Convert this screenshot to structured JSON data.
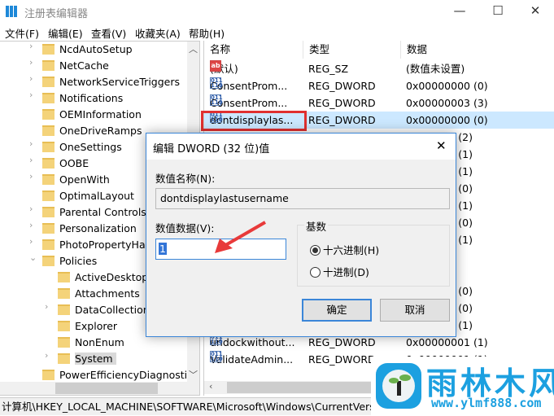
{
  "window": {
    "title": "注册表编辑器",
    "minimize": "—",
    "maximize": "☐",
    "close": "✕"
  },
  "menu": [
    "文件(F)",
    "编辑(E)",
    "查看(V)",
    "收藏夹(A)",
    "帮助(H)"
  ],
  "tree": {
    "items": [
      {
        "label": "NcdAutoSetup",
        "level": 1,
        "arrow": "›"
      },
      {
        "label": "NetCache",
        "level": 1,
        "arrow": "›"
      },
      {
        "label": "NetworkServiceTriggers",
        "level": 1,
        "arrow": "›"
      },
      {
        "label": "Notifications",
        "level": 1,
        "arrow": "›"
      },
      {
        "label": "OEMInformation",
        "level": 1,
        "arrow": ""
      },
      {
        "label": "OneDriveRamps",
        "level": 1,
        "arrow": ""
      },
      {
        "label": "OneSettings",
        "level": 1,
        "arrow": "›"
      },
      {
        "label": "OOBE",
        "level": 1,
        "arrow": "›"
      },
      {
        "label": "OpenWith",
        "level": 1,
        "arrow": "›"
      },
      {
        "label": "OptimalLayout",
        "level": 1,
        "arrow": ""
      },
      {
        "label": "Parental Controls",
        "level": 1,
        "arrow": "›"
      },
      {
        "label": "Personalization",
        "level": 1,
        "arrow": "›"
      },
      {
        "label": "PhotoPropertyHandler",
        "level": 1,
        "arrow": "›"
      },
      {
        "label": "Policies",
        "level": 1,
        "arrow": "⌄"
      },
      {
        "label": "ActiveDesktop",
        "level": 2,
        "arrow": ""
      },
      {
        "label": "Attachments",
        "level": 2,
        "arrow": ""
      },
      {
        "label": "DataCollection",
        "level": 2,
        "arrow": "›"
      },
      {
        "label": "Explorer",
        "level": 2,
        "arrow": ""
      },
      {
        "label": "NonEnum",
        "level": 2,
        "arrow": ""
      },
      {
        "label": "System",
        "level": 2,
        "arrow": "›",
        "selected": true
      },
      {
        "label": "PowerEfficiencyDiagnostics",
        "level": 1,
        "arrow": ""
      }
    ]
  },
  "list": {
    "headers": [
      "名称",
      "类型",
      "数据"
    ],
    "rows": [
      {
        "icon": "string-value-icon",
        "name": "(默认)",
        "type": "REG_SZ",
        "data": "(数值未设置)"
      },
      {
        "icon": "dword-value-icon",
        "name": "ConsentProm...",
        "type": "REG_DWORD",
        "data": "0x00000000 (0)"
      },
      {
        "icon": "dword-value-icon",
        "name": "ConsentProm...",
        "type": "REG_DWORD",
        "data": "0x00000003 (3)"
      },
      {
        "icon": "dword-value-icon",
        "name": "dontdisplaylas...",
        "type": "REG_DWORD",
        "data": "0x00000000 (0)",
        "selected": true
      },
      {
        "icon": "",
        "name": "",
        "type": "",
        "data": "2 (2)"
      },
      {
        "icon": "",
        "name": "",
        "type": "",
        "data": "(1)"
      },
      {
        "icon": "",
        "name": "",
        "type": "",
        "data": "(1)"
      },
      {
        "icon": "",
        "name": "",
        "type": "",
        "data": "0 (0)"
      },
      {
        "icon": "",
        "name": "",
        "type": "",
        "data": "(1)"
      },
      {
        "icon": "",
        "name": "",
        "type": "",
        "data": "0 (0)"
      },
      {
        "icon": "",
        "name": "",
        "type": "",
        "data": "(1)"
      },
      {
        "icon": "",
        "name": "",
        "type": "",
        "data": ""
      },
      {
        "icon": "",
        "name": "",
        "type": "",
        "data": ""
      },
      {
        "icon": "",
        "name": "",
        "type": "",
        "data": "0 (0)"
      },
      {
        "icon": "",
        "name": "",
        "type": "",
        "data": "0 (0)"
      },
      {
        "icon": "",
        "name": "",
        "type": "",
        "data": "(1)"
      },
      {
        "icon": "dword-value-icon",
        "name": "undockwithout...",
        "type": "REG_DWORD",
        "data": "0x00000001 (1)"
      },
      {
        "icon": "dword-value-icon",
        "name": "ValidateAdmin...",
        "type": "REG_DWORD",
        "data": "0x00000001 (1)"
      }
    ]
  },
  "status": "计算机\\HKEY_LOCAL_MACHINE\\SOFTWARE\\Microsoft\\Windows\\CurrentVersion\\Policies\\System",
  "dialog": {
    "title": "编辑 DWORD (32 位)值",
    "name_label": "数值名称(N):",
    "name_value": "dontdisplaylastusername",
    "data_label": "数值数据(V):",
    "data_value": "1",
    "base_label": "基数",
    "hex_label": "十六进制(H)",
    "dec_label": "十进制(D)",
    "base_selected": "hex",
    "ok": "确定",
    "cancel": "取消",
    "close": "✕"
  },
  "watermark": {
    "brand": "雨林木风",
    "url": "www.ylmf888.com"
  },
  "colors": {
    "accent": "#3b86d8",
    "highlight_box": "#e03030",
    "selected_row": "#cce8ff",
    "watermark": "#1ca0e0"
  }
}
